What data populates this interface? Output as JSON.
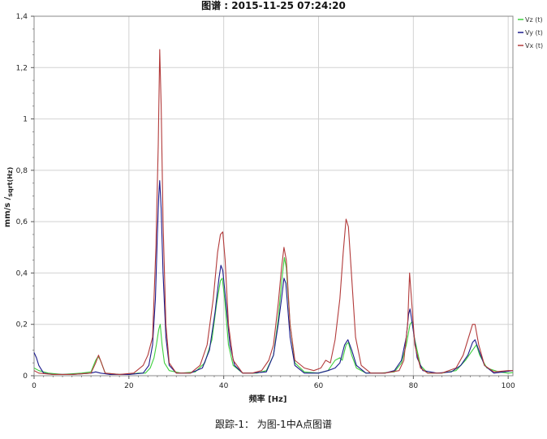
{
  "chart_data": {
    "type": "line",
    "title": "图谱 : 2015-11-25 07:24:20",
    "xlabel": "频率 [Hz]",
    "ylabel": "mm/s /sqrt(Hz)",
    "ylabel_main": "mm/s /",
    "ylabel_sub": "sqrt(Hz)",
    "xlim": [
      0,
      101
    ],
    "ylim": [
      0,
      1.4
    ],
    "xticks": [
      0,
      20,
      40,
      60,
      80,
      100
    ],
    "xtick_labels": [
      "0",
      "20",
      "40",
      "60",
      "80",
      "100"
    ],
    "yticks": [
      0,
      0.2,
      0.4,
      0.6,
      0.8,
      1,
      1.2,
      1.4
    ],
    "ytick_labels": [
      "0",
      "0,2",
      "0,4",
      "0,6",
      "0,8",
      "1",
      "1,2",
      "1,4"
    ],
    "grid": true,
    "legend_position": "top-right",
    "series": [
      {
        "name": "Vz (t)",
        "color": "#3fcf3f",
        "points": [
          [
            0,
            0.03
          ],
          [
            1,
            0.02
          ],
          [
            3,
            0.01
          ],
          [
            6,
            0.005
          ],
          [
            10,
            0.01
          ],
          [
            12,
            0.015
          ],
          [
            13,
            0.06
          ],
          [
            13.5,
            0.075
          ],
          [
            14,
            0.06
          ],
          [
            15,
            0.01
          ],
          [
            18,
            0.005
          ],
          [
            20,
            0.005
          ],
          [
            22,
            0.01
          ],
          [
            23.5,
            0.01
          ],
          [
            24.5,
            0.03
          ],
          [
            25.3,
            0.07
          ],
          [
            25.8,
            0.12
          ],
          [
            26.3,
            0.18
          ],
          [
            26.6,
            0.2
          ],
          [
            27,
            0.12
          ],
          [
            27.5,
            0.05
          ],
          [
            28.5,
            0.02
          ],
          [
            31,
            0.01
          ],
          [
            34,
            0.015
          ],
          [
            36,
            0.05
          ],
          [
            37.5,
            0.14
          ],
          [
            38.5,
            0.28
          ],
          [
            39.3,
            0.37
          ],
          [
            39.7,
            0.38
          ],
          [
            40.2,
            0.3
          ],
          [
            41,
            0.12
          ],
          [
            42,
            0.04
          ],
          [
            44,
            0.01
          ],
          [
            47,
            0.01
          ],
          [
            49,
            0.02
          ],
          [
            50.5,
            0.08
          ],
          [
            51.5,
            0.22
          ],
          [
            52.3,
            0.38
          ],
          [
            52.8,
            0.46
          ],
          [
            53.2,
            0.42
          ],
          [
            54,
            0.2
          ],
          [
            55,
            0.05
          ],
          [
            57,
            0.015
          ],
          [
            60,
            0.01
          ],
          [
            62,
            0.02
          ],
          [
            63.5,
            0.06
          ],
          [
            64.5,
            0.07
          ],
          [
            65,
            0.06
          ],
          [
            65.8,
            0.12
          ],
          [
            66.3,
            0.13
          ],
          [
            67,
            0.08
          ],
          [
            68,
            0.03
          ],
          [
            70,
            0.01
          ],
          [
            73,
            0.01
          ],
          [
            76,
            0.015
          ],
          [
            77.5,
            0.05
          ],
          [
            78.5,
            0.12
          ],
          [
            79.3,
            0.2
          ],
          [
            79.7,
            0.21
          ],
          [
            80.3,
            0.14
          ],
          [
            81.5,
            0.04
          ],
          [
            83,
            0.01
          ],
          [
            86,
            0.01
          ],
          [
            89,
            0.02
          ],
          [
            91,
            0.06
          ],
          [
            92.5,
            0.1
          ],
          [
            93.3,
            0.12
          ],
          [
            94,
            0.08
          ],
          [
            95.5,
            0.03
          ],
          [
            98,
            0.015
          ],
          [
            100,
            0.01
          ],
          [
            101,
            0.012
          ]
        ]
      },
      {
        "name": "Vy (t)",
        "color": "#1a1a8c",
        "points": [
          [
            0,
            0.09
          ],
          [
            0.5,
            0.07
          ],
          [
            1,
            0.04
          ],
          [
            2,
            0.01
          ],
          [
            4,
            0.005
          ],
          [
            8,
            0.005
          ],
          [
            12,
            0.01
          ],
          [
            13,
            0.015
          ],
          [
            14,
            0.01
          ],
          [
            16,
            0.005
          ],
          [
            20,
            0.005
          ],
          [
            23,
            0.01
          ],
          [
            24.2,
            0.04
          ],
          [
            25,
            0.12
          ],
          [
            25.6,
            0.3
          ],
          [
            26,
            0.55
          ],
          [
            26.3,
            0.7
          ],
          [
            26.5,
            0.76
          ],
          [
            26.8,
            0.65
          ],
          [
            27.2,
            0.4
          ],
          [
            27.8,
            0.15
          ],
          [
            28.5,
            0.04
          ],
          [
            30,
            0.01
          ],
          [
            33,
            0.01
          ],
          [
            35.5,
            0.03
          ],
          [
            37,
            0.1
          ],
          [
            38.2,
            0.25
          ],
          [
            39,
            0.38
          ],
          [
            39.4,
            0.43
          ],
          [
            39.8,
            0.41
          ],
          [
            40.5,
            0.28
          ],
          [
            41.3,
            0.12
          ],
          [
            42.3,
            0.04
          ],
          [
            44,
            0.01
          ],
          [
            46,
            0.01
          ],
          [
            49,
            0.015
          ],
          [
            50.5,
            0.08
          ],
          [
            51.5,
            0.2
          ],
          [
            52.2,
            0.3
          ],
          [
            52.7,
            0.38
          ],
          [
            53.1,
            0.36
          ],
          [
            54,
            0.15
          ],
          [
            55,
            0.04
          ],
          [
            57,
            0.01
          ],
          [
            60,
            0.01
          ],
          [
            62,
            0.02
          ],
          [
            63.5,
            0.03
          ],
          [
            64.5,
            0.05
          ],
          [
            65.5,
            0.12
          ],
          [
            66.2,
            0.14
          ],
          [
            67,
            0.1
          ],
          [
            68,
            0.04
          ],
          [
            70,
            0.01
          ],
          [
            74,
            0.01
          ],
          [
            76,
            0.02
          ],
          [
            77.5,
            0.06
          ],
          [
            78.5,
            0.15
          ],
          [
            79,
            0.24
          ],
          [
            79.3,
            0.26
          ],
          [
            79.8,
            0.2
          ],
          [
            80.8,
            0.07
          ],
          [
            82,
            0.02
          ],
          [
            85,
            0.01
          ],
          [
            88,
            0.015
          ],
          [
            90,
            0.04
          ],
          [
            91.5,
            0.08
          ],
          [
            92.5,
            0.13
          ],
          [
            93,
            0.14
          ],
          [
            93.8,
            0.1
          ],
          [
            95,
            0.04
          ],
          [
            97,
            0.01
          ],
          [
            99,
            0.015
          ],
          [
            101,
            0.02
          ]
        ]
      },
      {
        "name": "Vx (t)",
        "color": "#b23a3a",
        "points": [
          [
            0,
            0.02
          ],
          [
            1,
            0.01
          ],
          [
            4,
            0.005
          ],
          [
            8,
            0.005
          ],
          [
            12,
            0.01
          ],
          [
            13,
            0.05
          ],
          [
            13.6,
            0.08
          ],
          [
            14.2,
            0.05
          ],
          [
            15,
            0.01
          ],
          [
            18,
            0.005
          ],
          [
            21,
            0.01
          ],
          [
            23,
            0.04
          ],
          [
            24,
            0.08
          ],
          [
            25,
            0.15
          ],
          [
            25.7,
            0.5
          ],
          [
            26.2,
            0.9
          ],
          [
            26.5,
            1.27
          ],
          [
            26.8,
            1.05
          ],
          [
            27.2,
            0.6
          ],
          [
            27.8,
            0.2
          ],
          [
            28.5,
            0.05
          ],
          [
            30,
            0.01
          ],
          [
            33,
            0.01
          ],
          [
            35,
            0.04
          ],
          [
            36.5,
            0.12
          ],
          [
            37.8,
            0.3
          ],
          [
            38.7,
            0.48
          ],
          [
            39.3,
            0.55
          ],
          [
            39.8,
            0.56
          ],
          [
            40.3,
            0.45
          ],
          [
            41,
            0.2
          ],
          [
            42,
            0.06
          ],
          [
            44,
            0.01
          ],
          [
            46,
            0.01
          ],
          [
            48,
            0.02
          ],
          [
            49.5,
            0.06
          ],
          [
            50.5,
            0.12
          ],
          [
            51.5,
            0.28
          ],
          [
            52.2,
            0.42
          ],
          [
            52.7,
            0.5
          ],
          [
            53.2,
            0.45
          ],
          [
            54,
            0.2
          ],
          [
            55,
            0.06
          ],
          [
            57,
            0.03
          ],
          [
            59,
            0.02
          ],
          [
            60.5,
            0.03
          ],
          [
            61.5,
            0.06
          ],
          [
            62.5,
            0.05
          ],
          [
            63.5,
            0.14
          ],
          [
            64.5,
            0.3
          ],
          [
            65.2,
            0.48
          ],
          [
            65.8,
            0.61
          ],
          [
            66.3,
            0.58
          ],
          [
            67,
            0.38
          ],
          [
            67.8,
            0.15
          ],
          [
            69,
            0.04
          ],
          [
            71,
            0.01
          ],
          [
            74,
            0.01
          ],
          [
            77,
            0.02
          ],
          [
            78,
            0.06
          ],
          [
            78.8,
            0.2
          ],
          [
            79.2,
            0.4
          ],
          [
            79.6,
            0.3
          ],
          [
            80.3,
            0.12
          ],
          [
            81.5,
            0.03
          ],
          [
            83,
            0.01
          ],
          [
            86,
            0.01
          ],
          [
            89,
            0.03
          ],
          [
            90.5,
            0.08
          ],
          [
            91.5,
            0.14
          ],
          [
            92.5,
            0.2
          ],
          [
            93,
            0.2
          ],
          [
            93.8,
            0.12
          ],
          [
            95,
            0.04
          ],
          [
            97,
            0.015
          ],
          [
            100,
            0.02
          ],
          [
            101,
            0.02
          ]
        ]
      }
    ]
  },
  "caption": "跟踪-1： 为图-1中A点图谱"
}
